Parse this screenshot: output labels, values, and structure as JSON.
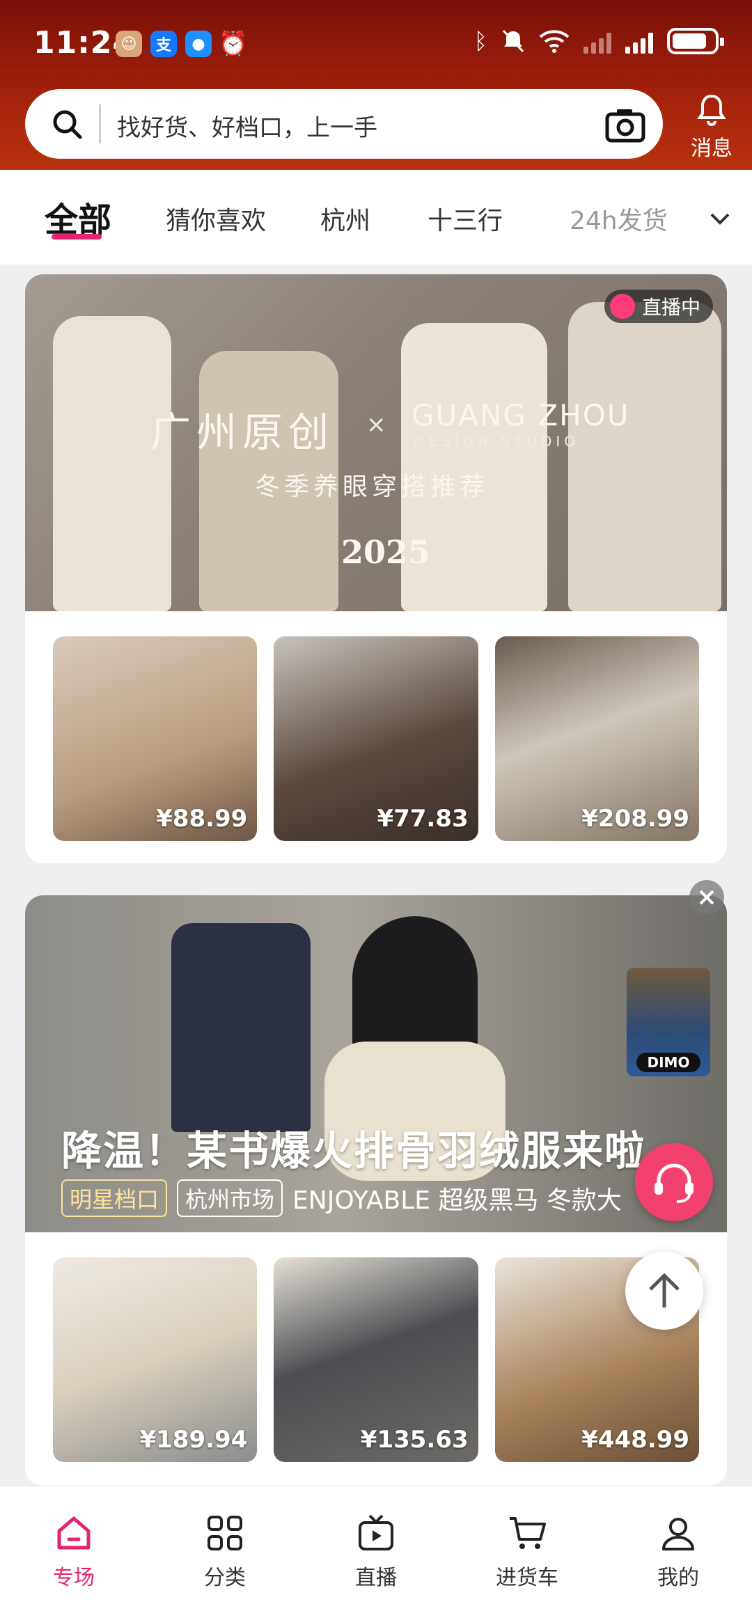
{
  "status_bar": {
    "time": "11:24"
  },
  "search": {
    "placeholder": "找好货、好档口，上一手"
  },
  "messages": {
    "label": "消息"
  },
  "tabs": [
    {
      "label": "全部",
      "active": true
    },
    {
      "label": "猜你喜欢"
    },
    {
      "label": "杭州"
    },
    {
      "label": "十三行"
    },
    {
      "label": "24h发货"
    }
  ],
  "card1": {
    "live_badge": "直播中",
    "title_cn": "广州原创",
    "title_x": "×",
    "title_en": "GUANG ZHOU",
    "title_en_sub": "DESIGN STUDIO",
    "subtitle": "冬季养眼穿搭推荐",
    "year": "2025",
    "products": [
      {
        "price": "¥88.99"
      },
      {
        "price": "¥77.83"
      },
      {
        "price": "¥208.99"
      }
    ]
  },
  "card2": {
    "headline": "降温！某书爆火排骨羽绒服来啦",
    "tags": [
      "明星档口",
      "杭州市场"
    ],
    "extra": "ENJOYABLE 超级黑马 冬款大",
    "dimo_label": "DIMO",
    "products": [
      {
        "price": "¥189.94"
      },
      {
        "price": "¥135.63"
      },
      {
        "price": "¥448.99"
      }
    ]
  },
  "bottom_nav": [
    {
      "label": "专场",
      "active": true,
      "icon": "home-icon"
    },
    {
      "label": "分类",
      "icon": "grid-icon"
    },
    {
      "label": "直播",
      "icon": "tv-icon"
    },
    {
      "label": "进货车",
      "icon": "cart-icon"
    },
    {
      "label": "我的",
      "icon": "user-icon"
    }
  ],
  "colors": {
    "accent": "#e3246e",
    "header_dark": "#7a0f06",
    "header_light": "#b8320f",
    "cs_button": "#f2416e"
  }
}
